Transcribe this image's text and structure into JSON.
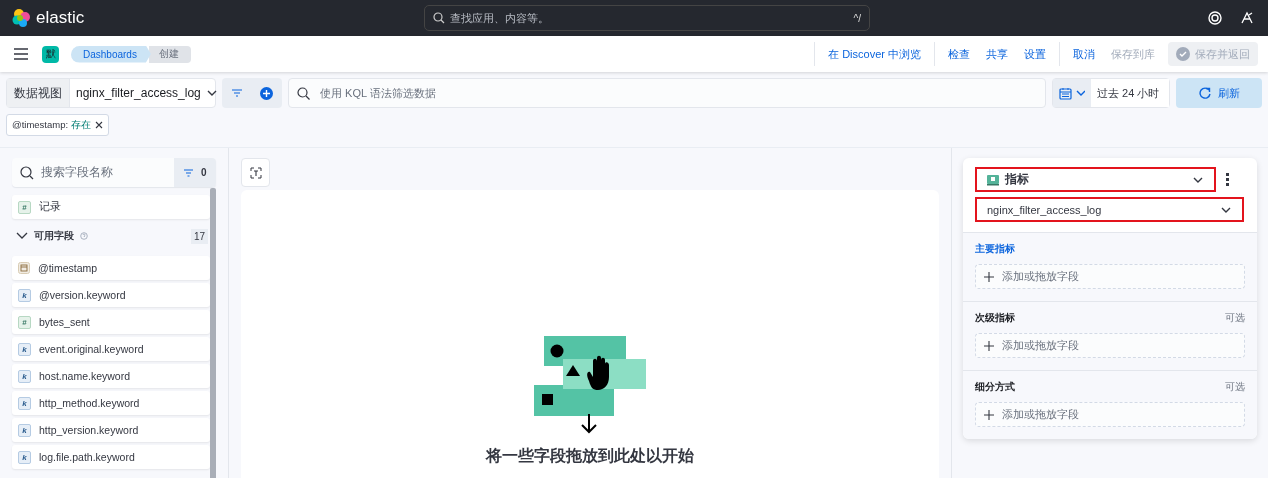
{
  "header": {
    "brand": "elastic",
    "search_placeholder": "查找应用、内容等。",
    "shortcut": "^/"
  },
  "nav": {
    "space_badge": "默",
    "breadcrumbs": [
      {
        "label": "Dashboards",
        "current": false
      },
      {
        "label": "创建",
        "current": true
      }
    ],
    "action_groups": [
      [
        {
          "label": "在 Discover 中浏览",
          "disabled": false
        }
      ],
      [
        {
          "label": "检查",
          "disabled": false
        },
        {
          "label": "共享",
          "disabled": false
        },
        {
          "label": "设置",
          "disabled": false
        }
      ],
      [
        {
          "label": "取消",
          "disabled": false
        },
        {
          "label": "保存到库",
          "disabled": true
        }
      ]
    ],
    "save_button": {
      "label": "保存并返回",
      "disabled": true
    }
  },
  "query": {
    "data_view_label": "数据视图",
    "data_view": "nginx_filter_access_log",
    "placeholder": "使用 KQL 语法筛选数据",
    "time_range": "过去 24 小时",
    "refresh": "刷新"
  },
  "filters": [
    {
      "field": "@timestamp:",
      "value": "存在"
    }
  ],
  "fields": {
    "search_placeholder": "搜索字段名称",
    "filter_count": "0",
    "records": {
      "kind": "number",
      "token": "#",
      "name": "记录"
    },
    "group": {
      "label": "可用字段",
      "count": "17",
      "expanded": true
    },
    "items": [
      {
        "kind": "date",
        "name": "@timestamp"
      },
      {
        "kind": "keyword",
        "token": "k",
        "name": "@version.keyword"
      },
      {
        "kind": "number",
        "token": "#",
        "name": "bytes_sent"
      },
      {
        "kind": "keyword",
        "token": "k",
        "name": "event.original.keyword"
      },
      {
        "kind": "keyword",
        "token": "k",
        "name": "host.name.keyword"
      },
      {
        "kind": "keyword",
        "token": "k",
        "name": "http_method.keyword"
      },
      {
        "kind": "keyword",
        "token": "k",
        "name": "http_version.keyword"
      },
      {
        "kind": "keyword",
        "token": "k",
        "name": "log.file.path.keyword"
      }
    ]
  },
  "workspace": {
    "empty_message": "将一些字段拖放到此处以开始"
  },
  "config": {
    "visualization": {
      "label": "指标",
      "highlighted": true
    },
    "data_view": {
      "label": "nginx_filter_access_log",
      "highlighted": true
    },
    "sections": [
      {
        "title": "主要指标",
        "required": true,
        "drop_label": "添加或拖放字段"
      },
      {
        "title": "次级指标",
        "required": false,
        "optional_label": "可选",
        "drop_label": "添加或拖放字段"
      },
      {
        "title": "细分方式",
        "required": false,
        "optional_label": "可选",
        "drop_label": "添加或拖放字段"
      }
    ]
  }
}
